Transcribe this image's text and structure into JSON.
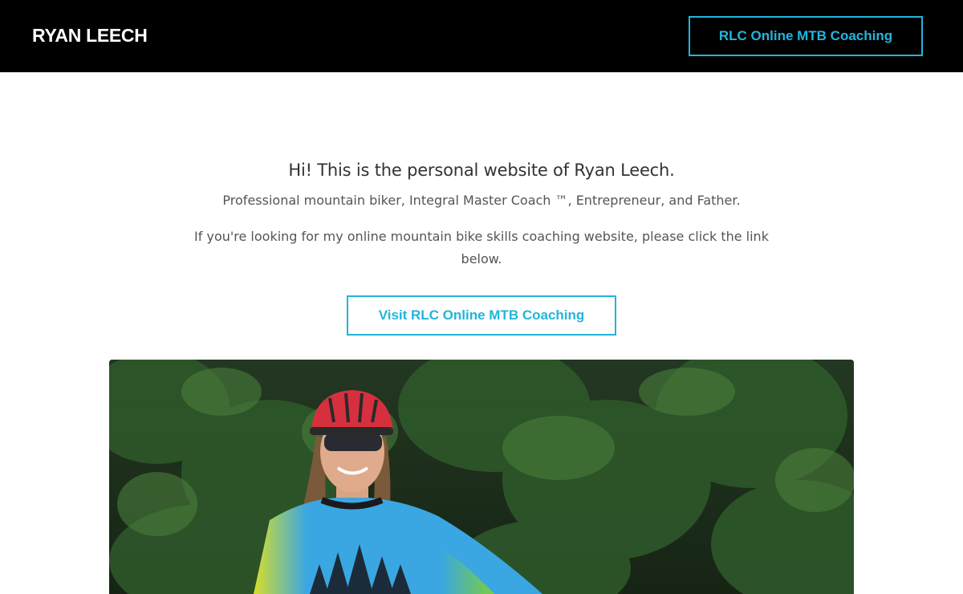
{
  "header": {
    "brand": "RYAN LEECH",
    "cta_label": "RLC Online MTB Coaching"
  },
  "intro": {
    "headline": "Hi! This is the personal website of Ryan Leech.",
    "subline": "Professional mountain biker, Integral Master Coach ™, Entrepreneur, and Father.",
    "paragraph": "If you're looking for my online mountain bike skills coaching website, please click the link below.",
    "cta_label": "Visit RLC Online MTB Coaching"
  },
  "colors": {
    "accent": "#22b5dc",
    "header_bg": "#000000",
    "page_bg": "#ffffff"
  }
}
